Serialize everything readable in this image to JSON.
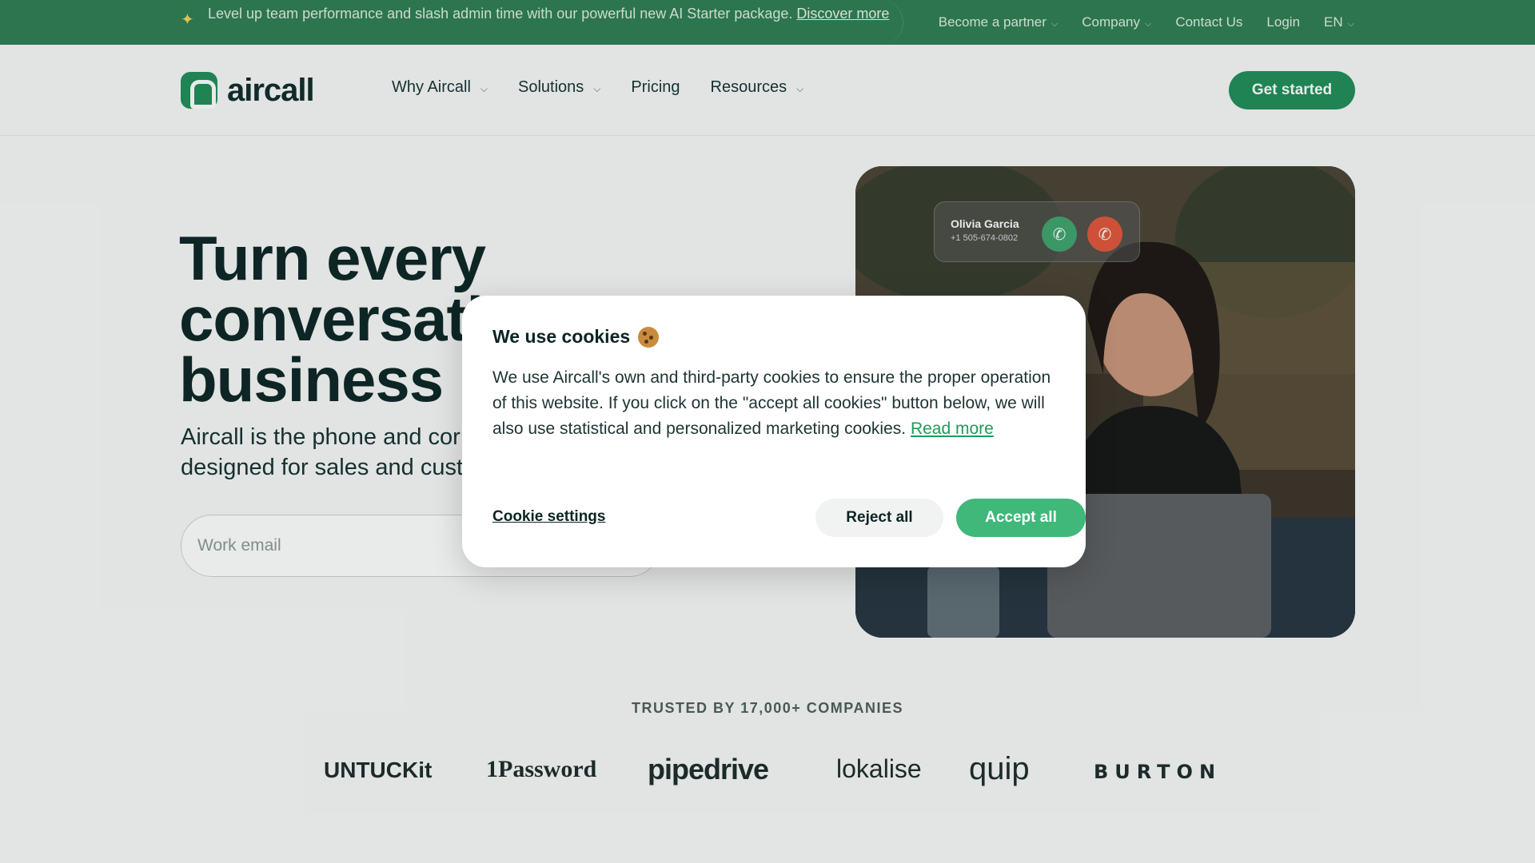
{
  "announcement": {
    "text": "Level up team performance and slash admin time with our powerful new AI Starter package.",
    "link": "Discover more",
    "icon": "sparkle-icon"
  },
  "topnav": {
    "partner": "Become a partner",
    "company": "Company",
    "contact": "Contact Us",
    "login": "Login",
    "language": "EN"
  },
  "nav": {
    "logo_text": "aircall",
    "items": [
      "Why Aircall",
      "Solutions",
      "Pricing",
      "Resources"
    ],
    "cta": "Get started"
  },
  "hero": {
    "title_lines": [
      "Turn every",
      "conversati",
      "business ir"
    ],
    "subtitle_lines": [
      "Aircall is the phone and cor",
      "designed for sales and cust"
    ],
    "email_placeholder": "Work email",
    "call_card": {
      "name": "Olivia Garcia",
      "number": "+1 505-674-0802"
    }
  },
  "trusted": {
    "heading": "TRUSTED BY 17,000+ COMPANIES",
    "logos": [
      "UNTUCKit",
      "1Password",
      "pipedrive",
      "lokalise",
      "quip",
      "BURTON"
    ]
  },
  "cookie_modal": {
    "title": "We use cookies",
    "body": "We use Aircall's own and third-party cookies to ensure the proper operation of this website. If you click on the \"accept all cookies\" button below, we will also use statistical and personalized marketing cookies.",
    "read_more": "Read more",
    "settings": "Cookie settings",
    "reject": "Reject all",
    "accept": "Accept all"
  },
  "colors": {
    "brand_green": "#1f8d58",
    "topbar_green": "#2e7d52",
    "accept_green": "#3fb87a",
    "decline_red": "#e0553a"
  }
}
